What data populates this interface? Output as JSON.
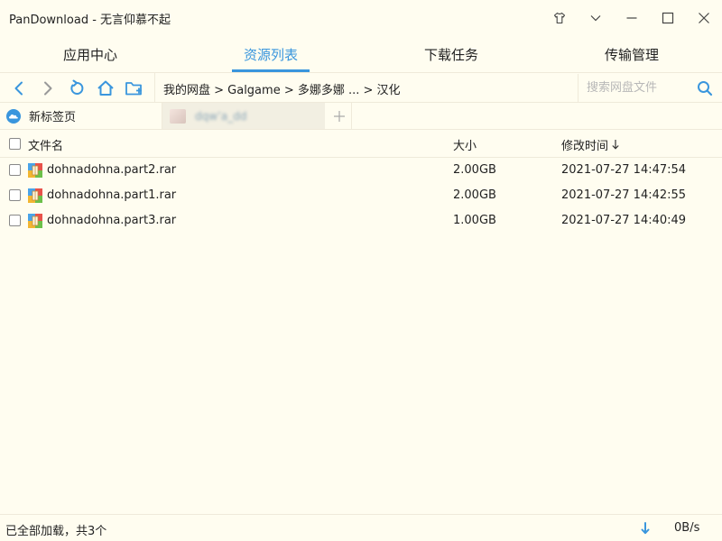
{
  "window": {
    "title": "PanDownload - 无言仰慕不起"
  },
  "tabs": [
    {
      "label": "应用中心"
    },
    {
      "label": "资源列表"
    },
    {
      "label": "下载任务"
    },
    {
      "label": "传输管理"
    }
  ],
  "toolbar": {
    "breadcrumb": "我的网盘 > Galgame > 多娜多娜 ... > 汉化",
    "search_placeholder": "搜索网盘文件"
  },
  "page_tabs": {
    "new_tab_label": "新标签页",
    "second_tab_label": "dqw’a_dd"
  },
  "file_list": {
    "headers": {
      "name": "文件名",
      "size": "大小",
      "modified": "修改时间"
    },
    "rows": [
      {
        "name": "dohnadohna.part2.rar",
        "size": "2.00GB",
        "modified": "2021-07-27 14:47:54"
      },
      {
        "name": "dohnadohna.part1.rar",
        "size": "2.00GB",
        "modified": "2021-07-27 14:42:55"
      },
      {
        "name": "dohnadohna.part3.rar",
        "size": "1.00GB",
        "modified": "2021-07-27 14:40:49"
      }
    ]
  },
  "status": {
    "text": "已全部加载，共3个",
    "speed": "0B/s"
  },
  "colors": {
    "accent": "#3a96dd",
    "background": "#fffdf0",
    "border": "#efeada"
  }
}
